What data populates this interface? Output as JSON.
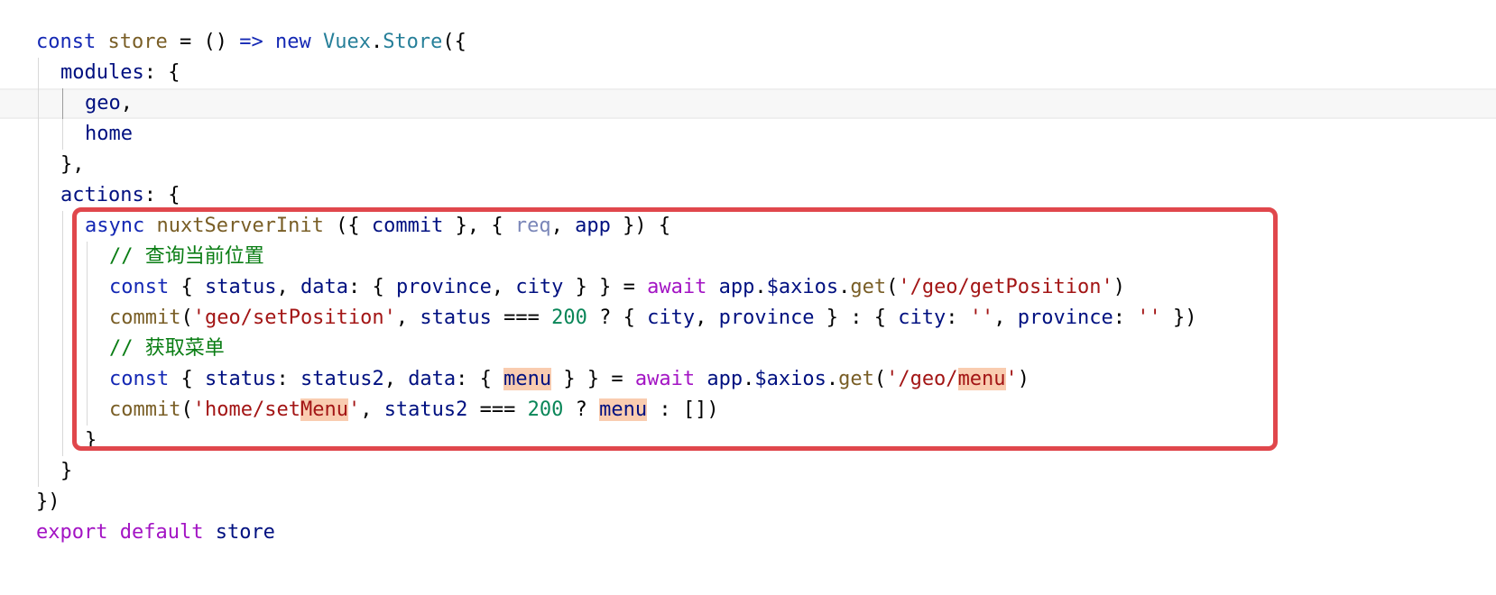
{
  "editor": {
    "lines": [
      {
        "indent": 0,
        "tokens": [
          {
            "c": "kw",
            "t": "const"
          },
          {
            "c": "plain",
            "t": " "
          },
          {
            "c": "fn",
            "t": "store"
          },
          {
            "c": "plain",
            "t": " = () "
          },
          {
            "c": "kw",
            "t": "=>"
          },
          {
            "c": "plain",
            "t": " "
          },
          {
            "c": "kw",
            "t": "new"
          },
          {
            "c": "plain",
            "t": " "
          },
          {
            "c": "cls",
            "t": "Vuex"
          },
          {
            "c": "plain",
            "t": "."
          },
          {
            "c": "cls",
            "t": "Store"
          },
          {
            "c": "plain",
            "t": "({"
          }
        ]
      },
      {
        "indent": 1,
        "tokens": [
          {
            "c": "id",
            "t": "modules"
          },
          {
            "c": "plain",
            "t": ": {"
          }
        ]
      },
      {
        "indent": 2,
        "current": true,
        "tokens": [
          {
            "c": "id",
            "t": "geo"
          },
          {
            "c": "plain",
            "t": ","
          }
        ]
      },
      {
        "indent": 2,
        "tokens": [
          {
            "c": "id",
            "t": "home"
          }
        ]
      },
      {
        "indent": 1,
        "tokens": [
          {
            "c": "plain",
            "t": "},"
          }
        ]
      },
      {
        "indent": 1,
        "tokens": [
          {
            "c": "id",
            "t": "actions"
          },
          {
            "c": "plain",
            "t": ": {"
          }
        ]
      },
      {
        "indent": 2,
        "tokens": [
          {
            "c": "kw",
            "t": "async"
          },
          {
            "c": "plain",
            "t": " "
          },
          {
            "c": "fn",
            "t": "nuxtServerInit"
          },
          {
            "c": "plain",
            "t": " ({ "
          },
          {
            "c": "id",
            "t": "commit"
          },
          {
            "c": "plain",
            "t": " }, { "
          },
          {
            "c": "dim",
            "t": "req"
          },
          {
            "c": "plain",
            "t": ", "
          },
          {
            "c": "id",
            "t": "app"
          },
          {
            "c": "plain",
            "t": " }) {"
          }
        ]
      },
      {
        "indent": 3,
        "tokens": [
          {
            "c": "cmt",
            "t": "// 查询当前位置"
          }
        ]
      },
      {
        "indent": 3,
        "tokens": [
          {
            "c": "kw",
            "t": "const"
          },
          {
            "c": "plain",
            "t": " { "
          },
          {
            "c": "id",
            "t": "status"
          },
          {
            "c": "plain",
            "t": ", "
          },
          {
            "c": "id",
            "t": "data"
          },
          {
            "c": "plain",
            "t": ": { "
          },
          {
            "c": "id",
            "t": "province"
          },
          {
            "c": "plain",
            "t": ", "
          },
          {
            "c": "id",
            "t": "city"
          },
          {
            "c": "plain",
            "t": " } } = "
          },
          {
            "c": "kw2",
            "t": "await"
          },
          {
            "c": "plain",
            "t": " "
          },
          {
            "c": "id",
            "t": "app"
          },
          {
            "c": "plain",
            "t": "."
          },
          {
            "c": "id",
            "t": "$axios"
          },
          {
            "c": "plain",
            "t": "."
          },
          {
            "c": "fn",
            "t": "get"
          },
          {
            "c": "plain",
            "t": "("
          },
          {
            "c": "str",
            "t": "'/geo/getPosition'"
          },
          {
            "c": "plain",
            "t": ")"
          }
        ]
      },
      {
        "indent": 3,
        "tokens": [
          {
            "c": "fn",
            "t": "commit"
          },
          {
            "c": "plain",
            "t": "("
          },
          {
            "c": "str",
            "t": "'geo/setPosition'"
          },
          {
            "c": "plain",
            "t": ", "
          },
          {
            "c": "id",
            "t": "status"
          },
          {
            "c": "plain",
            "t": " === "
          },
          {
            "c": "num",
            "t": "200"
          },
          {
            "c": "plain",
            "t": " ? { "
          },
          {
            "c": "id",
            "t": "city"
          },
          {
            "c": "plain",
            "t": ", "
          },
          {
            "c": "id",
            "t": "province"
          },
          {
            "c": "plain",
            "t": " } : { "
          },
          {
            "c": "id",
            "t": "city"
          },
          {
            "c": "plain",
            "t": ": "
          },
          {
            "c": "str",
            "t": "''"
          },
          {
            "c": "plain",
            "t": ", "
          },
          {
            "c": "id",
            "t": "province"
          },
          {
            "c": "plain",
            "t": ": "
          },
          {
            "c": "str",
            "t": "''"
          },
          {
            "c": "plain",
            "t": " })"
          }
        ]
      },
      {
        "indent": 3,
        "tokens": [
          {
            "c": "cmt",
            "t": "// 获取菜单"
          }
        ]
      },
      {
        "indent": 3,
        "tokens": [
          {
            "c": "kw",
            "t": "const"
          },
          {
            "c": "plain",
            "t": " { "
          },
          {
            "c": "id",
            "t": "status"
          },
          {
            "c": "plain",
            "t": ": "
          },
          {
            "c": "id",
            "t": "status2"
          },
          {
            "c": "plain",
            "t": ", "
          },
          {
            "c": "id",
            "t": "data"
          },
          {
            "c": "plain",
            "t": ": { "
          },
          {
            "c": "id",
            "t": "menu",
            "hl": true
          },
          {
            "c": "plain",
            "t": " } } = "
          },
          {
            "c": "kw2",
            "t": "await"
          },
          {
            "c": "plain",
            "t": " "
          },
          {
            "c": "id",
            "t": "app"
          },
          {
            "c": "plain",
            "t": "."
          },
          {
            "c": "id",
            "t": "$axios"
          },
          {
            "c": "plain",
            "t": "."
          },
          {
            "c": "fn",
            "t": "get"
          },
          {
            "c": "plain",
            "t": "("
          },
          {
            "c": "str",
            "t": "'/geo/"
          },
          {
            "c": "str",
            "t": "menu",
            "hl": true
          },
          {
            "c": "str",
            "t": "'"
          },
          {
            "c": "plain",
            "t": ")"
          }
        ]
      },
      {
        "indent": 3,
        "tokens": [
          {
            "c": "fn",
            "t": "commit"
          },
          {
            "c": "plain",
            "t": "("
          },
          {
            "c": "str",
            "t": "'home/set"
          },
          {
            "c": "str",
            "t": "Menu",
            "hl": true
          },
          {
            "c": "str",
            "t": "'"
          },
          {
            "c": "plain",
            "t": ", "
          },
          {
            "c": "id",
            "t": "status2"
          },
          {
            "c": "plain",
            "t": " === "
          },
          {
            "c": "num",
            "t": "200"
          },
          {
            "c": "plain",
            "t": " ? "
          },
          {
            "c": "id",
            "t": "menu",
            "hl": true
          },
          {
            "c": "plain",
            "t": " : [])"
          }
        ]
      },
      {
        "indent": 2,
        "tokens": [
          {
            "c": "plain",
            "t": "}"
          }
        ]
      },
      {
        "indent": 1,
        "tokens": [
          {
            "c": "plain",
            "t": "}"
          }
        ]
      },
      {
        "indent": 0,
        "tokens": [
          {
            "c": "plain",
            "t": "})"
          }
        ]
      },
      {
        "indent": 0,
        "tokens": [
          {
            "c": "kw2",
            "t": "export"
          },
          {
            "c": "plain",
            "t": " "
          },
          {
            "c": "kw2",
            "t": "default"
          },
          {
            "c": "plain",
            "t": " "
          },
          {
            "c": "id",
            "t": "store"
          }
        ]
      }
    ],
    "highlight_box_color": "#e0474c",
    "word_highlight_color": "#f9ccb0"
  }
}
